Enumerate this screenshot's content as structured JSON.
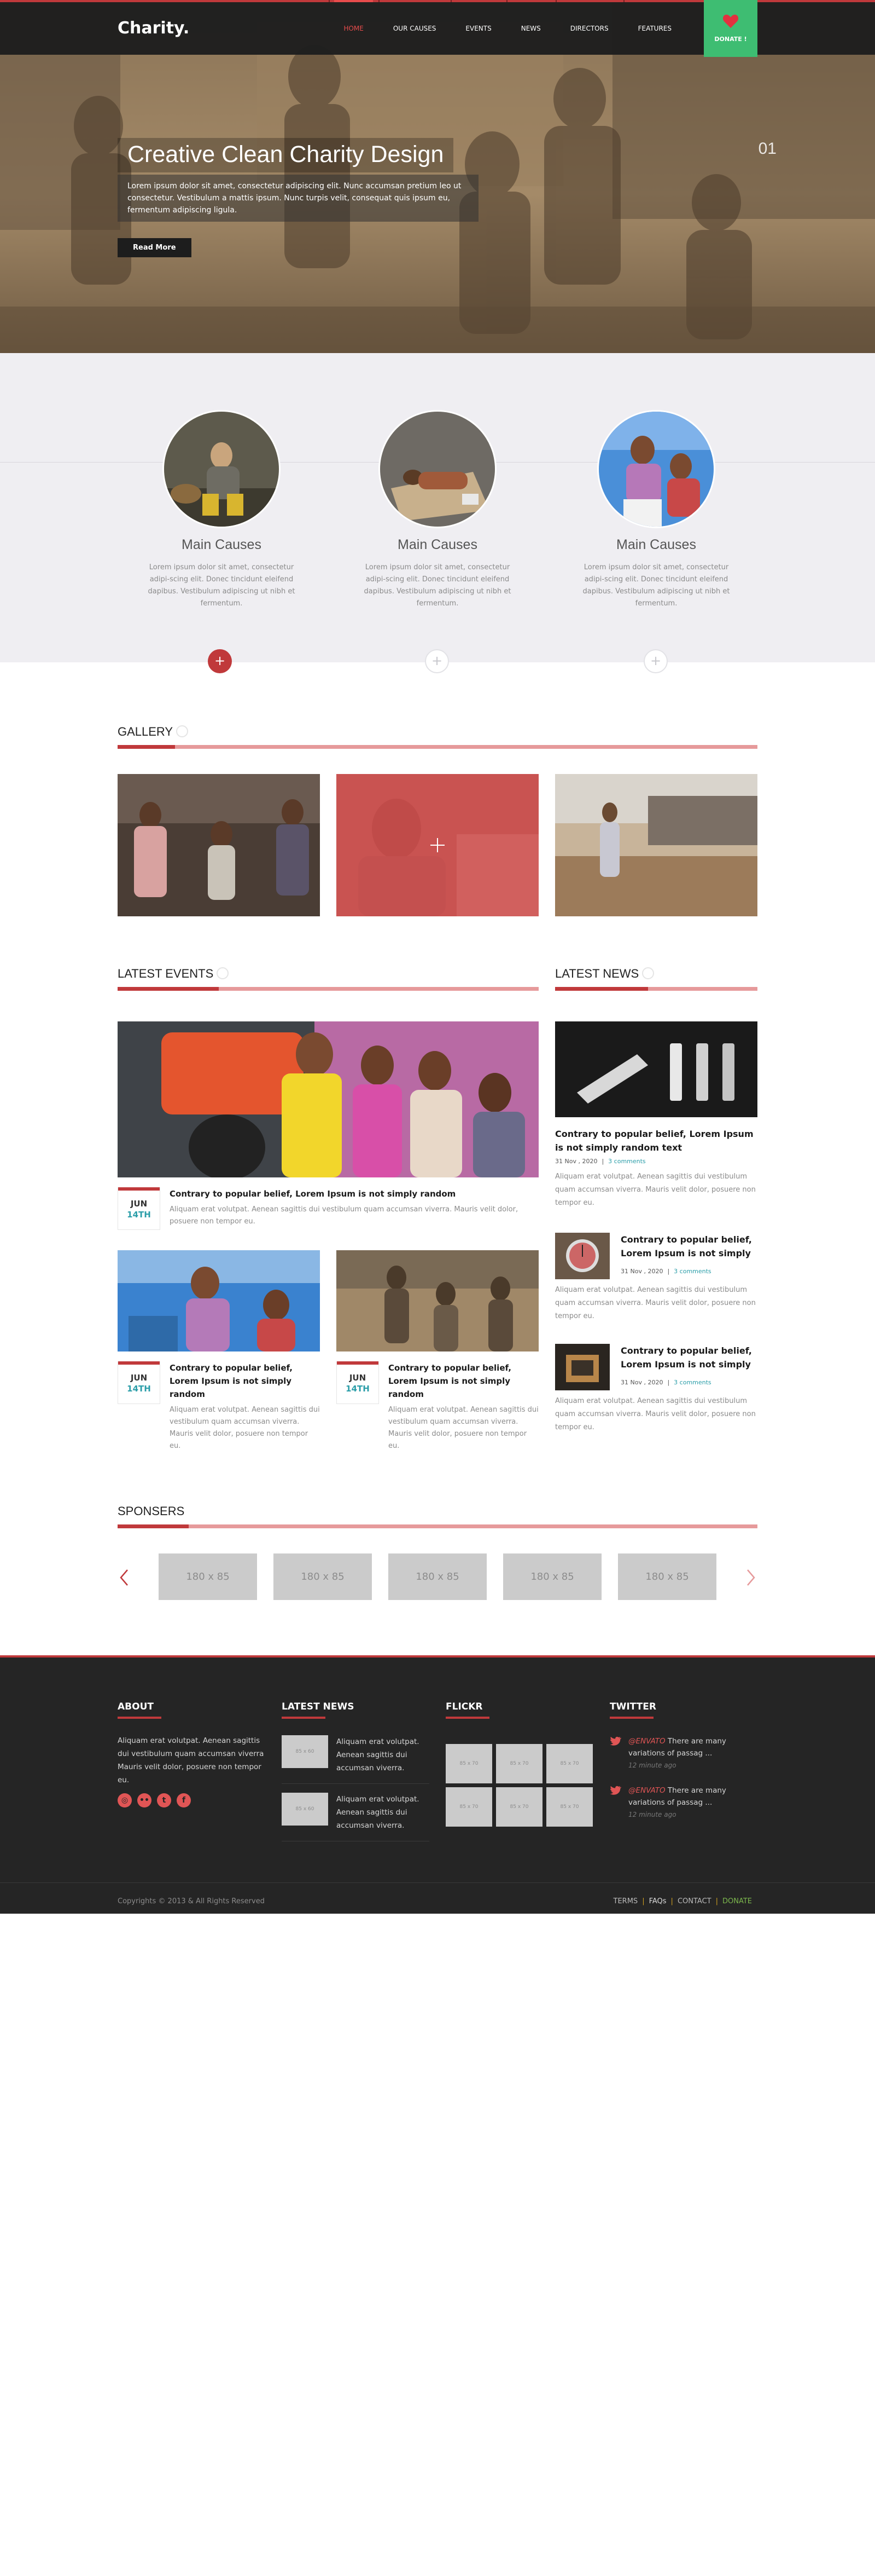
{
  "header": {
    "logo": "Charity.",
    "nav": [
      {
        "label": "HOME",
        "active": true
      },
      {
        "label": "OUR CAUSES",
        "active": false
      },
      {
        "label": "EVENTS",
        "active": false
      },
      {
        "label": "NEWS",
        "active": false
      },
      {
        "label": "DIRECTORS",
        "active": false
      },
      {
        "label": "FEATURES",
        "active": false
      }
    ],
    "donate_label": "DONATE !"
  },
  "hero": {
    "title": "Creative Clean Charity Design",
    "text": "Lorem ipsum dolor sit amet, consectetur adipiscing elit. Nunc accumsan pretium leo ut consectetur. Vestibulum a mattis ipsum. Nunc turpis velit, consequat quis ipsum eu, fermentum adipiscing ligula.",
    "button": "Read More",
    "counter": "01"
  },
  "causes": [
    {
      "title": "Main Causes",
      "text": "Lorem ipsum dolor sit amet, consectetur adipi-scing elit. Donec tincidunt eleifend dapibus. Vestibulum adipiscing ut nibh et fermentum.",
      "active": true
    },
    {
      "title": "Main Causes",
      "text": "Lorem ipsum dolor sit amet, consectetur adipi-scing elit. Donec tincidunt eleifend dapibus. Vestibulum adipiscing ut nibh et fermentum.",
      "active": false
    },
    {
      "title": "Main Causes",
      "text": "Lorem ipsum dolor sit amet, consectetur adipi-scing elit. Donec tincidunt eleifend dapibus. Vestibulum adipiscing ut nibh et fermentum.",
      "active": false
    }
  ],
  "gallery": {
    "heading": "GALLERY"
  },
  "events": {
    "heading": "LATEST EVENTS",
    "main": {
      "month": "JUN",
      "day": "14TH",
      "title": "Contrary to popular belief, Lorem Ipsum is not simply random",
      "text": "Aliquam erat volutpat. Aenean sagittis dui vestibulum quam accumsan viverra. Mauris velit dolor, posuere non tempor eu."
    },
    "small": [
      {
        "month": "JUN",
        "day": "14TH",
        "title": "Contrary to popular belief, Lorem Ipsum is not simply random",
        "text": "Aliquam erat volutpat. Aenean sagittis dui vestibulum quam accumsan viverra. Mauris velit dolor, posuere non tempor eu."
      },
      {
        "month": "JUN",
        "day": "14TH",
        "title": "Contrary to popular belief, Lorem Ipsum is not simply random",
        "text": "Aliquam erat volutpat. Aenean sagittis dui vestibulum quam accumsan viverra. Mauris velit dolor, posuere non tempor eu."
      }
    ]
  },
  "news": {
    "heading": "LATEST NEWS",
    "items": [
      {
        "title": "Contrary to popular belief, Lorem Ipsum is not simply random text",
        "date": "31 Nov , 2020",
        "comments": "3 comments",
        "text": "Aliquam erat volutpat. Aenean sagittis dui vestibulum quam accumsan viverra. Mauris velit dolor, posuere non tempor eu."
      },
      {
        "title": "Contrary to popular belief, Lorem Ipsum is not simply",
        "date": "31 Nov , 2020",
        "comments": "3 comments",
        "text": "Aliquam erat volutpat. Aenean sagittis dui vestibulum quam accumsan viverra. Mauris velit dolor, posuere non tempor eu."
      },
      {
        "title": "Contrary to popular belief, Lorem Ipsum is not simply",
        "date": "31 Nov , 2020",
        "comments": "3 comments",
        "text": "Aliquam erat volutpat. Aenean sagittis dui vestibulum quam accumsan viverra. Mauris velit dolor, posuere non tempor eu."
      }
    ]
  },
  "sponsors": {
    "heading": "SPONSERS",
    "logos": [
      "180 x 85",
      "180 x 85",
      "180 x 85",
      "180 x 85",
      "180 x 85"
    ]
  },
  "footer": {
    "about": {
      "heading": "ABOUT",
      "text": "Aliquam erat volutpat. Aenean sagittis dui vestibulum quam accumsan viverra Mauris velit dolor, posuere non tempor eu."
    },
    "latest_news": {
      "heading": "LATEST NEWS",
      "items": [
        {
          "thumb": "85 x 60",
          "text": "Aliquam erat volutpat. Aenean sagittis dui accumsan viverra."
        },
        {
          "thumb": "85 x 60",
          "text": "Aliquam erat volutpat. Aenean sagittis dui accumsan viverra."
        }
      ]
    },
    "flickr": {
      "heading": "FLICKR",
      "thumbs": [
        "85 x 70",
        "85 x 70",
        "85 x 70",
        "85 x 70",
        "85 x 70",
        "85 x 70"
      ]
    },
    "twitter": {
      "heading": "TWITTER",
      "tweets": [
        {
          "user": "@ENVATO",
          "text": "There are many variations of passag ...",
          "ago": "12 minute ago"
        },
        {
          "user": "@ENVATO",
          "text": "There are many variations of passag ...",
          "ago": "12 minute ago"
        }
      ]
    },
    "copyright": "Copyrights © 2013 & All Rights Reserved",
    "links": {
      "terms": "TERMS",
      "faqs": "FAQs",
      "contact": "CONTACT",
      "donate": "DONATE"
    }
  },
  "colors": {
    "accent": "#c0393b",
    "donate": "#3ebd72",
    "dark": "#252525",
    "teal": "#2a9da8"
  }
}
